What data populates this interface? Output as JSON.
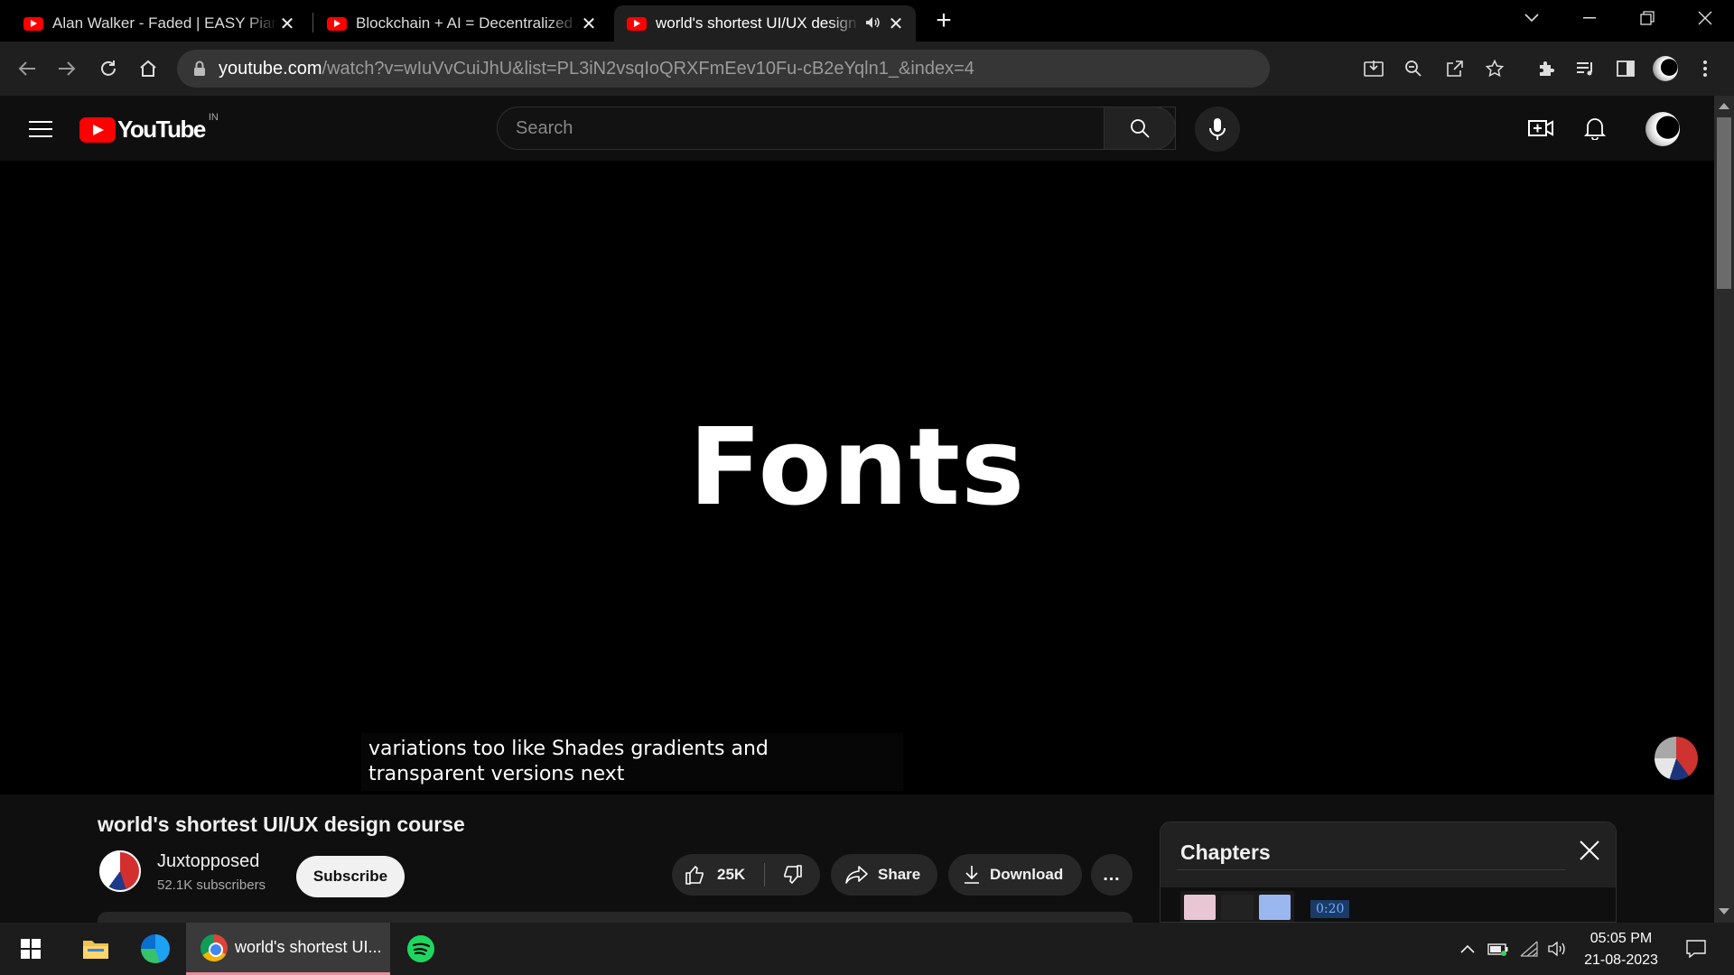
{
  "browser": {
    "tabs": [
      {
        "title": "Alan Walker - Faded | EASY Piano"
      },
      {
        "title": "Blockchain + AI = Decentralized AI"
      },
      {
        "title": "world's shortest UI/UX design course",
        "active": true
      }
    ],
    "url_host": "youtube.com",
    "url_path": "/watch?v=wIuVvCuiJhU&list=PL3iN2vsqIoQRXFmEev10Fu-cB2eYqln1_&index=4"
  },
  "youtube": {
    "logo_text": "YouTube",
    "region": "IN",
    "search_placeholder": "Search"
  },
  "player": {
    "frame_text": "Fonts",
    "caption_line1": "variations too like Shades gradients and",
    "caption_line2": "transparent versions next"
  },
  "video": {
    "title": "world's shortest UI/UX design course",
    "channel": "Juxtopposed",
    "subscribers": "52.1K subscribers",
    "subscribe_label": "Subscribe",
    "likes": "25K",
    "share_label": "Share",
    "download_label": "Download",
    "more_label": "…"
  },
  "chapters": {
    "title": "Chapters",
    "first_time": "0:20"
  },
  "taskbar": {
    "chrome_label": "world's shortest UI...",
    "time": "05:05 PM",
    "date": "21-08-2023"
  },
  "colors": {
    "youtube_red": "#ff0000",
    "background": "#0f0f0f",
    "chip": "#272727"
  }
}
